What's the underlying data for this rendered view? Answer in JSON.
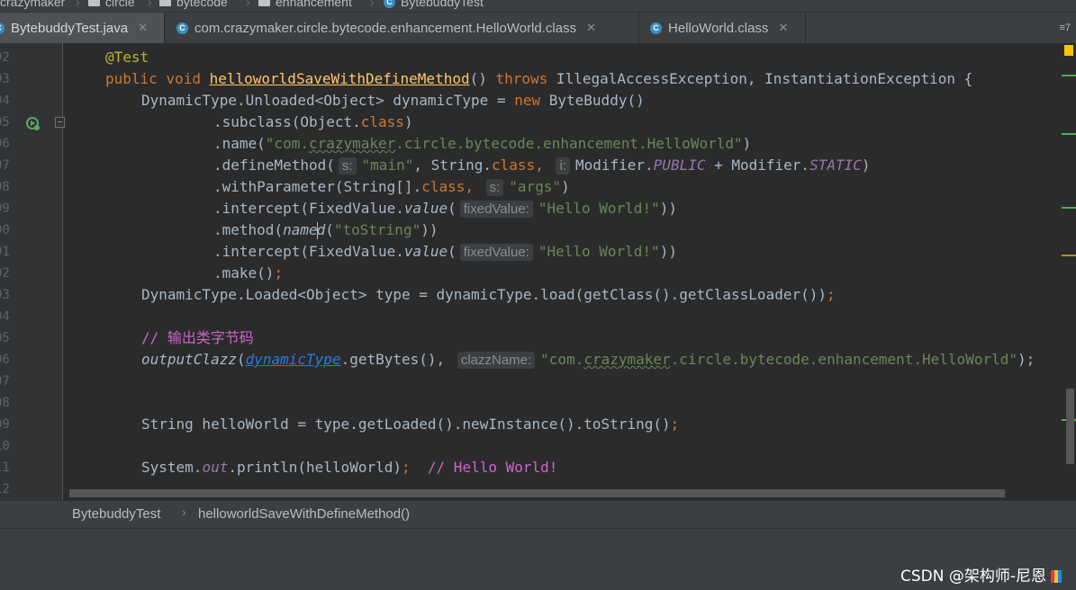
{
  "nav": {
    "crumbs": [
      "crazymaker",
      "circle",
      "bytecode",
      "enhancement",
      "BytebuddyTest"
    ]
  },
  "tabs": [
    {
      "label": "BytebuddyTest.java",
      "active": true
    },
    {
      "label": "com.crazymaker.circle.bytecode.enhancement.HelloWorld.class",
      "active": false
    },
    {
      "label": "HelloWorld.class",
      "active": false
    }
  ],
  "tab_overflow": "≡7",
  "gutter": {
    "line_numbers": [
      "92",
      "93",
      "94",
      "95",
      "96",
      "97",
      "98",
      "99",
      "00",
      "01",
      "02",
      "03",
      "04",
      "05",
      "06",
      "07",
      "08",
      "09",
      "10",
      "11",
      "12"
    ]
  },
  "code": {
    "l92_annotation": "@Test",
    "l93_public": "public",
    "l93_void": "void",
    "l93_method": "helloworldSaveWithDefineMethod",
    "l93_parens": "() ",
    "l93_throws": "throws",
    "l93_exceptions": " IllegalAccessException, InstantiationException {",
    "l94_pre": "DynamicType.Unloaded<Object> dynamicType = ",
    "l94_new": "new",
    "l94_post": " ByteBuddy()",
    "l95_pre": ".subclass(Object.",
    "l95_class": "class",
    "l95_post": ")",
    "l96_pre": ".name(",
    "l96_str_a": "\"com.",
    "l96_str_typo": "crazymaker",
    "l96_str_b": ".circle.bytecode.enhancement.HelloWorld\"",
    "l96_post": ")",
    "l97_pre": ".defineMethod(",
    "l97_hint1": "s:",
    "l97_str": "\"main\"",
    "l97_mid": ", String.",
    "l97_class": "class",
    "l97_comma": ", ",
    "l97_hint2": "i:",
    "l97_mod1": "Modifier.",
    "l97_public": "PUBLIC",
    "l97_plus": " + Modifier.",
    "l97_static": "STATIC",
    "l97_post": ")",
    "l98_pre": ".withParameter(String[].",
    "l98_class": "class",
    "l98_comma": ", ",
    "l98_hint": "s:",
    "l98_str": "\"args\"",
    "l98_post": ")",
    "l99_pre": ".intercept(FixedValue.",
    "l99_value": "value",
    "l99_paren": "(",
    "l99_hint": "fixedValue:",
    "l99_str": "\"Hello World!\"",
    "l99_post": "))",
    "l00_pre": ".method(",
    "l00_named_a": "name",
    "l00_named_b": "d",
    "l00_paren": "(",
    "l00_str": "\"toString\"",
    "l00_post": "))",
    "l01_pre": ".intercept(FixedValue.",
    "l01_value": "value",
    "l01_paren": "(",
    "l01_hint": "fixedValue:",
    "l01_str": "\"Hello World!\"",
    "l01_post": "))",
    "l02_text": ".make()",
    "l02_semi": ";",
    "l03_text": "DynamicType.Loaded<Object> type = dynamicType.load(getClass().getClassLoader())",
    "l03_semi": ";",
    "l05_comment_prefix": "// ",
    "l05_comment_text": "输出类字节码",
    "l06_method": "outputClazz",
    "l06_paren": "(",
    "l06_arg": "dynamicType",
    "l06_mid": ".getBytes(), ",
    "l06_hint": "clazzName:",
    "l06_str_a": "\"com.",
    "l06_str_typo": "crazymaker",
    "l06_str_b": ".circle.bytecode.enhancement.HelloWorld\"",
    "l06_post": ");",
    "l09_text": "String helloWorld = type.getLoaded().newInstance().toString()",
    "l09_semi": ";",
    "l11_pre": "System.",
    "l11_out": "out",
    "l11_mid": ".println(helloWorld)",
    "l11_semi": ";",
    "l11_comment": "  // Hello World!"
  },
  "breadcrumb": {
    "class": "BytebuddyTest",
    "separator": "›",
    "method": "helloworldSaveWithDefineMethod()"
  },
  "watermark": "CSDN @架构师-尼恩",
  "colors": {
    "keyword": "#cc7832",
    "string": "#6a8759",
    "annotation": "#bbb529",
    "constant": "#9876aa",
    "comment": "#cc66cc",
    "background": "#2b2b2b"
  }
}
